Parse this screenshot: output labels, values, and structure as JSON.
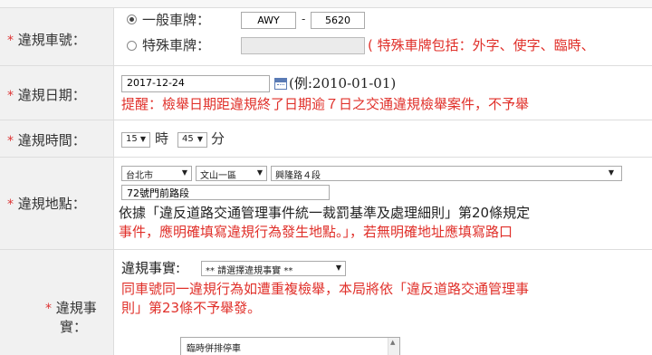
{
  "plate": {
    "label": "違規車號：",
    "general_label": "一般車牌：",
    "plate_prefix": "AWY",
    "separator": "-",
    "plate_number": "5620",
    "special_label": "特殊車牌：",
    "special_note": "( 特殊車牌包括：外字、使字、臨時、"
  },
  "date": {
    "label": "違規日期：",
    "value": "2017-12-24",
    "example": "(例:2010-01-01)",
    "reminder": "提醒：檢舉日期距違規終了日期逾７日之交通違規檢舉案件，不予舉"
  },
  "time": {
    "label": "違規時間：",
    "hour": "15",
    "hour_unit": "時",
    "minute": "45",
    "minute_unit": "分"
  },
  "location": {
    "label": "違規地點：",
    "city": "台北市",
    "district": "文山一區",
    "road": "興隆路４段",
    "detail": "72號門前路段",
    "note_line1": "依據「違反道路交通管理事件統一裁罰基準及處理細則」第20條規定",
    "note_line2": "事件，應明確填寫違規行為發生地點。」，若無明確地址應填寫路口"
  },
  "fact": {
    "label_line1": "違規事",
    "label_line2": "實：",
    "select_label": "違規事實:",
    "select_value": "** 請選擇違規事實 **",
    "note_line1": "同車號同一違規行為如遭重複檢舉，本局將依「違反道路交通管理事",
    "note_line2": "則」第23條不予舉發。",
    "textarea_value": "臨時併排停車"
  },
  "colors": {
    "required_star": "#d33333",
    "warning_text": "#e0302a",
    "label_bg": "#f1f1f1"
  }
}
